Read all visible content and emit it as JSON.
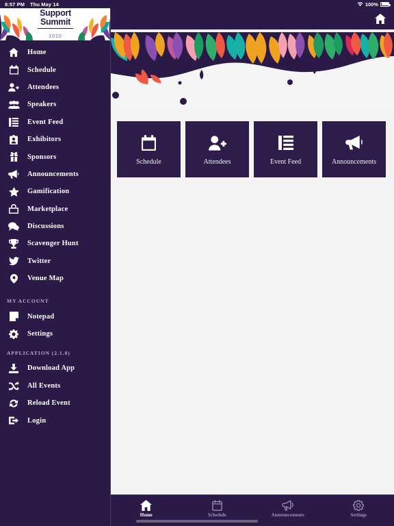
{
  "statusbar": {
    "time": "8:57 PM",
    "date": "Thu May 14",
    "battery": "100%",
    "wifi_icon": "wifi-icon",
    "battery_icon": "battery-full-icon"
  },
  "header": {
    "home_icon": "home-icon"
  },
  "sidebar": {
    "logo": {
      "line1": "Support",
      "line2": "Summit",
      "year": "2020"
    },
    "items": [
      {
        "label": "Home",
        "icon": "home-icon"
      },
      {
        "label": "Schedule",
        "icon": "calendar-icon"
      },
      {
        "label": "Attendees",
        "icon": "person-add-icon"
      },
      {
        "label": "Speakers",
        "icon": "people-group-icon"
      },
      {
        "label": "Event Feed",
        "icon": "list-icon"
      },
      {
        "label": "Exhibitors",
        "icon": "badge-icon"
      },
      {
        "label": "Sponsors",
        "icon": "gift-icon"
      },
      {
        "label": "Announcements",
        "icon": "megaphone-icon"
      },
      {
        "label": "Gamification",
        "icon": "star-icon"
      },
      {
        "label": "Marketplace",
        "icon": "shopping-bag-icon"
      },
      {
        "label": "Discussions",
        "icon": "chat-bubbles-icon"
      },
      {
        "label": "Scavenger Hunt",
        "icon": "trophy-icon"
      },
      {
        "label": "Twitter",
        "icon": "twitter-icon"
      },
      {
        "label": "Venue Map",
        "icon": "map-pin-icon"
      }
    ],
    "account_section": {
      "title": "MY ACCOUNT",
      "items": [
        {
          "label": "Notepad",
          "icon": "notepad-icon"
        },
        {
          "label": "Settings",
          "icon": "gear-icon"
        }
      ]
    },
    "application_section": {
      "title": "APPLICATION (2.1.0)",
      "items": [
        {
          "label": "Download App",
          "icon": "download-icon"
        },
        {
          "label": "All Events",
          "icon": "shuffle-icon"
        },
        {
          "label": "Reload Event",
          "icon": "reload-icon"
        },
        {
          "label": "Login",
          "icon": "login-icon"
        }
      ]
    }
  },
  "main": {
    "tiles": [
      {
        "label": "Schedule",
        "icon": "calendar-icon"
      },
      {
        "label": "Attendees",
        "icon": "person-add-icon"
      },
      {
        "label": "Event Feed",
        "icon": "list-icon"
      },
      {
        "label": "Announcements",
        "icon": "megaphone-icon"
      }
    ]
  },
  "tabbar": {
    "tabs": [
      {
        "label": "Home",
        "icon": "home-icon",
        "active": true
      },
      {
        "label": "Schedule",
        "icon": "calendar-icon",
        "active": false
      },
      {
        "label": "Announcements",
        "icon": "megaphone-icon",
        "active": false
      },
      {
        "label": "Settings",
        "icon": "gear-icon",
        "active": false
      }
    ]
  },
  "colors": {
    "brand_purple": "#2b1a48",
    "tile_purple": "#2e1d4b",
    "page_bg": "#f4f4f5",
    "muted_lavender": "#9b8fb5"
  }
}
